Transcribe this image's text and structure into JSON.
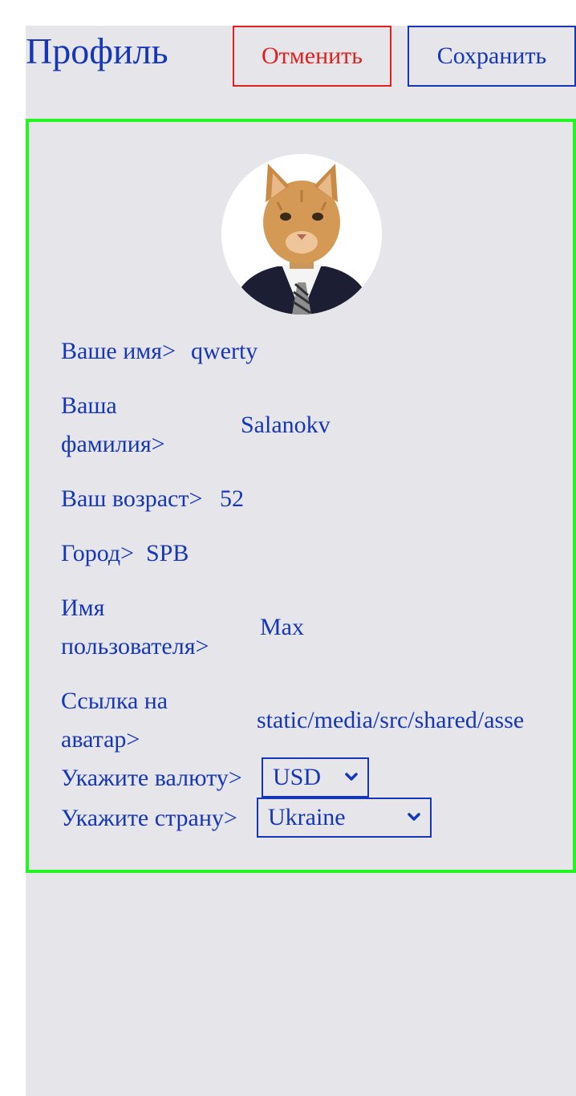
{
  "header": {
    "title": "Профиль",
    "cancel_label": "Отменить",
    "save_label": "Сохранить"
  },
  "profile": {
    "first_name_label": "Ваше имя>",
    "first_name_value": "qwerty",
    "last_name_label_1": "Ваша",
    "last_name_label_2": "фамилия>",
    "last_name_value": "Salanokv",
    "age_label": "Ваш возраст>",
    "age_value": "52",
    "city_label": "Город>",
    "city_value": "SPB",
    "username_label_1": "Имя",
    "username_label_2": "пользователя>",
    "username_value": "Max",
    "avatar_link_label_1": "Ссылка на",
    "avatar_link_label_2": "аватар>",
    "avatar_link_value": "static/media/src/shared/asse",
    "currency_label": "Укажите валюту>",
    "currency_value": "USD",
    "country_label": "Укажите страну>",
    "country_value": "Ukraine"
  },
  "colors": {
    "text": "#1636b8",
    "cancel": "#e21f1f",
    "card_border": "#22f522",
    "panel_bg": "#e6e6ea"
  }
}
